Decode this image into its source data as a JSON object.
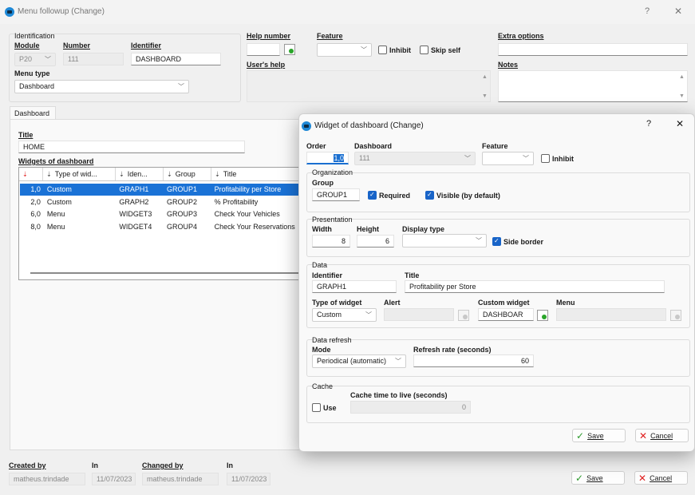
{
  "main_window": {
    "title": "Menu followup (Change)",
    "help_btn": "?",
    "close_btn": "✕",
    "identification": {
      "legend": "Identification",
      "module_label": "Module",
      "module_value": "P20",
      "number_label": "Number",
      "number_value": "111",
      "identifier_label": "Identifier",
      "identifier_value": "DASHBOARD",
      "menu_type_label": "Menu type",
      "menu_type_value": "Dashboard"
    },
    "help_number_label": "Help number",
    "help_number_value": "",
    "feature_label": "Feature",
    "feature_value": "",
    "inhibit_label": "Inhibit",
    "inhibit_checked": false,
    "skip_self_label": "Skip self",
    "skip_self_checked": false,
    "users_help_label": "User's help",
    "users_help_value": "",
    "extra_options_label": "Extra options",
    "extra_options_value": "",
    "notes_label": "Notes",
    "notes_value": "",
    "tabs": [
      {
        "label": "Dashboard",
        "active": true
      }
    ],
    "dashboard": {
      "title_label": "Title",
      "title_value": "HOME",
      "widgets_label": "Widgets of dashboard",
      "columns": [
        "",
        "Type of wid...",
        "Iden...",
        "Group",
        "Title"
      ],
      "rows": [
        {
          "order": "1,0",
          "type": "Custom",
          "identifier": "GRAPH1",
          "group": "GROUP1",
          "title": "Profitability per Store",
          "selected": true
        },
        {
          "order": "2,0",
          "type": "Custom",
          "identifier": "GRAPH2",
          "group": "GROUP2",
          "title": "% Profitability",
          "selected": false
        },
        {
          "order": "6,0",
          "type": "Menu",
          "identifier": "WIDGET3",
          "group": "GROUP3",
          "title": "Check Your Vehicles",
          "selected": false
        },
        {
          "order": "8,0",
          "type": "Menu",
          "identifier": "WIDGET4",
          "group": "GROUP4",
          "title": "Check Your Reservations",
          "selected": false
        }
      ]
    },
    "footer": {
      "created_by_label": "Created by",
      "created_by_value": "matheus.trindade",
      "created_in_label": "In",
      "created_in_value": "11/07/2023",
      "changed_by_label": "Changed by",
      "changed_by_value": "matheus.trindade",
      "changed_in_label": "In",
      "changed_in_value": "11/07/2023",
      "save_label": "Save",
      "cancel_label": "Cancel"
    }
  },
  "widget_dialog": {
    "title": "Widget of dashboard (Change)",
    "help_btn": "?",
    "close_btn": "✕",
    "order_label": "Order",
    "order_value": "1,0",
    "dashboard_label": "Dashboard",
    "dashboard_value": "111",
    "feature_label": "Feature",
    "feature_value": "",
    "inhibit_label": "Inhibit",
    "inhibit_checked": false,
    "organization": {
      "legend": "Organization",
      "group_label": "Group",
      "group_value": "GROUP1",
      "required_label": "Required",
      "required_checked": true,
      "visible_label": "Visible (by default)",
      "visible_checked": true
    },
    "presentation": {
      "legend": "Presentation",
      "width_label": "Width",
      "width_value": "8",
      "height_label": "Height",
      "height_value": "6",
      "display_type_label": "Display type",
      "display_type_value": "",
      "side_border_label": "Side border",
      "side_border_checked": true
    },
    "data": {
      "legend": "Data",
      "identifier_label": "Identifier",
      "identifier_value": "GRAPH1",
      "title_label": "Title",
      "title_value": "Profitability per Store",
      "type_label": "Type of widget",
      "type_value": "Custom",
      "alert_label": "Alert",
      "alert_value": "",
      "custom_widget_label": "Custom widget",
      "custom_widget_value": "DASHBOAR",
      "menu_label": "Menu",
      "menu_value": ""
    },
    "data_refresh": {
      "legend": "Data refresh",
      "mode_label": "Mode",
      "mode_value": "Periodical (automatic)",
      "rate_label": "Refresh rate (seconds)",
      "rate_value": "60"
    },
    "cache": {
      "legend": "Cache",
      "use_label": "Use",
      "use_checked": false,
      "ttl_label": "Cache time to live (seconds)",
      "ttl_value": "0"
    },
    "save_label": "Save",
    "cancel_label": "Cancel"
  }
}
